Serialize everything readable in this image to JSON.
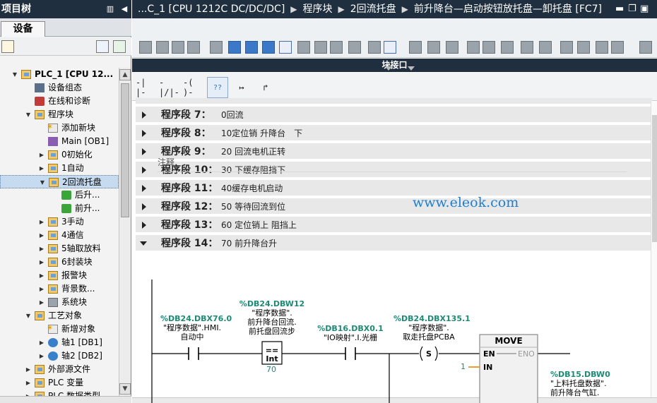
{
  "left_panel": {
    "title": "项目树",
    "tab": "设备",
    "tree": [
      {
        "level": 1,
        "expanded": true,
        "icon": "folder-icon",
        "label": "PLC_1 [CPU 12...",
        "bold": true
      },
      {
        "level": 2,
        "icon": "device-config-icon",
        "label": "设备组态"
      },
      {
        "level": 2,
        "icon": "online-diagnostics-icon",
        "label": "在线和诊断"
      },
      {
        "level": 2,
        "expanded": true,
        "icon": "folder-icon",
        "label": "程序块"
      },
      {
        "level": 3,
        "icon": "add-block-icon",
        "label": "添加新块"
      },
      {
        "level": 3,
        "icon": "ob-icon",
        "label": "Main [OB1]"
      },
      {
        "level": 3,
        "collapsed": true,
        "icon": "folder-icon",
        "label": "0初始化"
      },
      {
        "level": 3,
        "collapsed": true,
        "icon": "folder-icon",
        "label": "1自动"
      },
      {
        "level": 3,
        "expanded": true,
        "icon": "folder-icon",
        "label": "2回流托盘",
        "selected": true
      },
      {
        "level": 4,
        "icon": "fc-icon",
        "label": "后升..."
      },
      {
        "level": 4,
        "icon": "fc-icon",
        "label": "前升..."
      },
      {
        "level": 3,
        "collapsed": true,
        "icon": "folder-icon",
        "label": "3手动"
      },
      {
        "level": 3,
        "collapsed": true,
        "icon": "folder-icon",
        "label": "4通信"
      },
      {
        "level": 3,
        "collapsed": true,
        "icon": "folder-icon",
        "label": "5轴取放料"
      },
      {
        "level": 3,
        "collapsed": true,
        "icon": "folder-icon",
        "label": "6封装块"
      },
      {
        "level": 3,
        "collapsed": true,
        "icon": "folder-icon",
        "label": "报警块"
      },
      {
        "level": 3,
        "collapsed": true,
        "icon": "folder-icon",
        "label": "背景数..."
      },
      {
        "level": 3,
        "collapsed": true,
        "icon": "system-block-icon",
        "label": "系统块"
      },
      {
        "level": 2,
        "expanded": true,
        "icon": "folder-icon",
        "label": "工艺对象"
      },
      {
        "level": 3,
        "icon": "add-object-icon",
        "label": "新增对象"
      },
      {
        "level": 3,
        "collapsed": true,
        "icon": "axis-icon",
        "label": "轴1 [DB1]"
      },
      {
        "level": 3,
        "collapsed": true,
        "icon": "axis-icon",
        "label": "轴2 [DB2]"
      },
      {
        "level": 2,
        "collapsed": true,
        "icon": "folder-icon",
        "label": "外部源文件"
      },
      {
        "level": 2,
        "collapsed": true,
        "icon": "folder-icon",
        "label": "PLC 变量"
      },
      {
        "level": 2,
        "collapsed": true,
        "icon": "folder-icon",
        "label": "PLC 数据类型"
      }
    ]
  },
  "editor": {
    "breadcrumbs": [
      "...C_1 [CPU 1212C DC/DC/DC]",
      "程序块",
      "2回流托盘",
      "前升降台—启动按钮放托盘—卸托盘 [FC7]"
    ],
    "interface_label": "块接口",
    "ladder_tools": [
      "-| |-",
      "-|/|-",
      "-( )-",
      "??",
      "↦",
      "↱"
    ],
    "networks": [
      {
        "label": "程序段 7：",
        "title": "0回流",
        "expanded": false
      },
      {
        "label": "程序段 8：",
        "title": "10定位销 升降台　下",
        "expanded": false
      },
      {
        "label": "程序段 9：",
        "title": "20 回流电机正转",
        "expanded": false
      },
      {
        "label": "程序段 10：",
        "title": "30 下缓存阻挡下",
        "expanded": false
      },
      {
        "label": "程序段 11：",
        "title": "40缓存电机启动",
        "expanded": false
      },
      {
        "label": "程序段 12：",
        "title": "50 等待回流到位",
        "expanded": false
      },
      {
        "label": "程序段 13：",
        "title": "60 定位销上 阻挡上",
        "expanded": false
      },
      {
        "label": "程序段 14：",
        "title": "70 前升降台升",
        "expanded": true
      }
    ],
    "comment_placeholder": "注释",
    "ladder": {
      "contact1": {
        "address": "%DB24.DBX76.0",
        "name1": "\"程序数据\".HMI.",
        "name2": "自动中"
      },
      "compare": {
        "address": "%DB24.DBW12",
        "name1": "\"程序数据\".",
        "name2": "前升降台回流.",
        "name3": "前托盘回流步",
        "op": "==",
        "type": "Int",
        "value": "70"
      },
      "contact2": {
        "address": "%DB16.DBX0.1",
        "name1": "\"IO映射\".I.光栅"
      },
      "coil": {
        "address": "%DB24.DBX135.1",
        "name1": "\"程序数据\".",
        "name2": "取走托盘PCBA",
        "symbol": "S"
      },
      "move": {
        "title": "MOVE",
        "en": "EN",
        "eno": "ENO",
        "in": "IN",
        "in_value": "1",
        "out_address": "%DB15.DBW0",
        "out_name1": "\"上料托盘数据\".",
        "out_name2": "前升降台气缸."
      }
    }
  },
  "watermark": "www.eleok.com",
  "colors": {
    "title_bar": "#1f2f3f",
    "address": "#1d8a76",
    "watermark": "#1e7fd0"
  }
}
